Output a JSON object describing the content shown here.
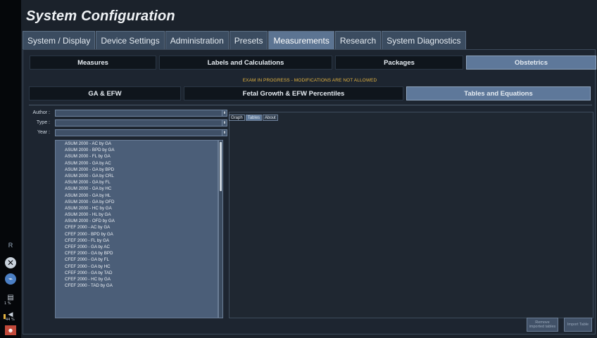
{
  "title": "System Configuration",
  "main_tabs": [
    {
      "label": "System / Display"
    },
    {
      "label": "Device Settings"
    },
    {
      "label": "Administration"
    },
    {
      "label": "Presets"
    },
    {
      "label": "Measurements"
    },
    {
      "label": "Research"
    },
    {
      "label": "System Diagnostics"
    }
  ],
  "active_main_tab": "Measurements",
  "sub_tabs": [
    {
      "label": "Measures"
    },
    {
      "label": "Labels and Calculations"
    },
    {
      "label": "Packages"
    },
    {
      "label": "Obstetrics"
    }
  ],
  "warning": "EXAM IN PROGRESS - MODIFICATIONS ARE NOT ALLOWED",
  "sub_tabs2": [
    {
      "label": "GA & EFW"
    },
    {
      "label": "Fetal Growth & EFW Percentiles"
    },
    {
      "label": "Tables and Equations"
    }
  ],
  "filters": {
    "author_label": "Author :",
    "type_label": "Type :",
    "year_label": "Year :"
  },
  "tables": [
    "ASUM 2000 - AC by GA",
    "ASUM 2000 - BPD by GA",
    "ASUM 2000 - FL by GA",
    "ASUM 2000 - GA by AC",
    "ASUM 2000 - GA by BPD",
    "ASUM 2000 - GA by CRL",
    "ASUM 2000 - GA by FL",
    "ASUM 2000 - GA by HC",
    "ASUM 2000 - GA by HL",
    "ASUM 2000 - GA by OFD",
    "ASUM 2000 - HC by GA",
    "ASUM 2000 - HL by GA",
    "ASUM 2000 - OFD by GA",
    "CFEF 2000 - AC by GA",
    "CFEF 2000 - BPD by GA",
    "CFEF 2000 - FL by GA",
    "CFEF 2000 - GA by AC",
    "CFEF 2000 - GA by BPD",
    "CFEF 2000 - GA by FL",
    "CFEF 2000 - GA by HC",
    "CFEF 2000 - GA by TAD",
    "CFEF 2000 - HC by GA",
    "CFEF 2000 - TAD by GA"
  ],
  "graph_tabs": [
    {
      "label": "Graph"
    },
    {
      "label": "Tables"
    },
    {
      "label": "About"
    }
  ],
  "buttons": {
    "remove_label": "Remove imported tables",
    "import_label": "Import Table"
  },
  "left_strip": {
    "marker": "R",
    "percent_1": "1 %",
    "percent_2": "44 %"
  },
  "colors": {
    "accent": "#5e789a",
    "warning": "#e3b340",
    "background": "#1b222b"
  }
}
